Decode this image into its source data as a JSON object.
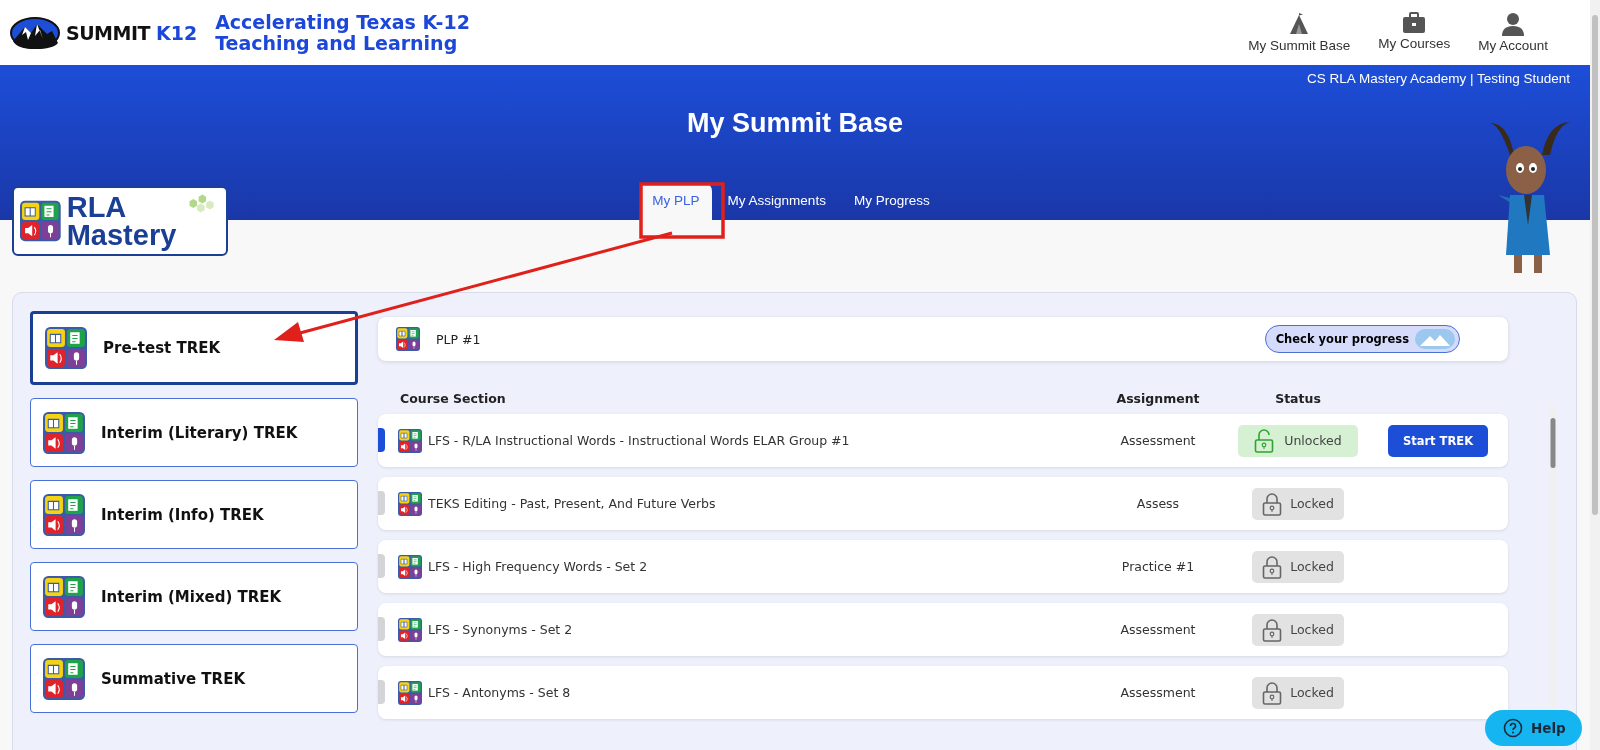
{
  "brand": {
    "name": "SUMMIT",
    "suffix": "K12",
    "tagline_1": "Accelerating Texas K-12",
    "tagline_2": "Teaching and Learning"
  },
  "top_nav": [
    {
      "label": "My Summit Base"
    },
    {
      "label": "My Courses"
    },
    {
      "label": "My Account"
    }
  ],
  "user_info": "CS RLA Mastery Academy | Testing Student",
  "page_title": "My Summit Base",
  "program_logo": {
    "line_1": "RLA",
    "line_2": "Mastery"
  },
  "tabs": [
    {
      "label": "My PLP",
      "selected": true
    },
    {
      "label": "My Assignments",
      "selected": false
    },
    {
      "label": "My Progress",
      "selected": false
    }
  ],
  "treks": [
    {
      "label": "Pre-test TREK",
      "selected": true
    },
    {
      "label": "Interim (Literary) TREK",
      "selected": false
    },
    {
      "label": "Interim (Info) TREK",
      "selected": false
    },
    {
      "label": "Interim (Mixed) TREK",
      "selected": false
    },
    {
      "label": "Summative TREK",
      "selected": false
    }
  ],
  "plp": {
    "title": "PLP #1",
    "progress_button": "Check your progress"
  },
  "table": {
    "columns": [
      "Course Section",
      "Assignment",
      "Status"
    ],
    "rows": [
      {
        "section": "LFS - R/LA Instructional Words - Instructional Words ELAR Group #1",
        "assignment": "Assessment",
        "status": "Unlocked",
        "locked": false,
        "selected": true,
        "action": "Start TREK"
      },
      {
        "section": "TEKS Editing - Past, Present, And Future Verbs",
        "assignment": "Assess",
        "status": "Locked",
        "locked": true,
        "selected": false
      },
      {
        "section": "LFS - High Frequency Words - Set 2",
        "assignment": "Practice #1",
        "status": "Locked",
        "locked": true,
        "selected": false
      },
      {
        "section": "LFS - Synonyms - Set 2",
        "assignment": "Assessment",
        "status": "Locked",
        "locked": true,
        "selected": false
      },
      {
        "section": "LFS - Antonyms - Set 8",
        "assignment": "Assessment",
        "status": "Locked",
        "locked": true,
        "selected": false
      }
    ]
  },
  "help_button": "Help"
}
